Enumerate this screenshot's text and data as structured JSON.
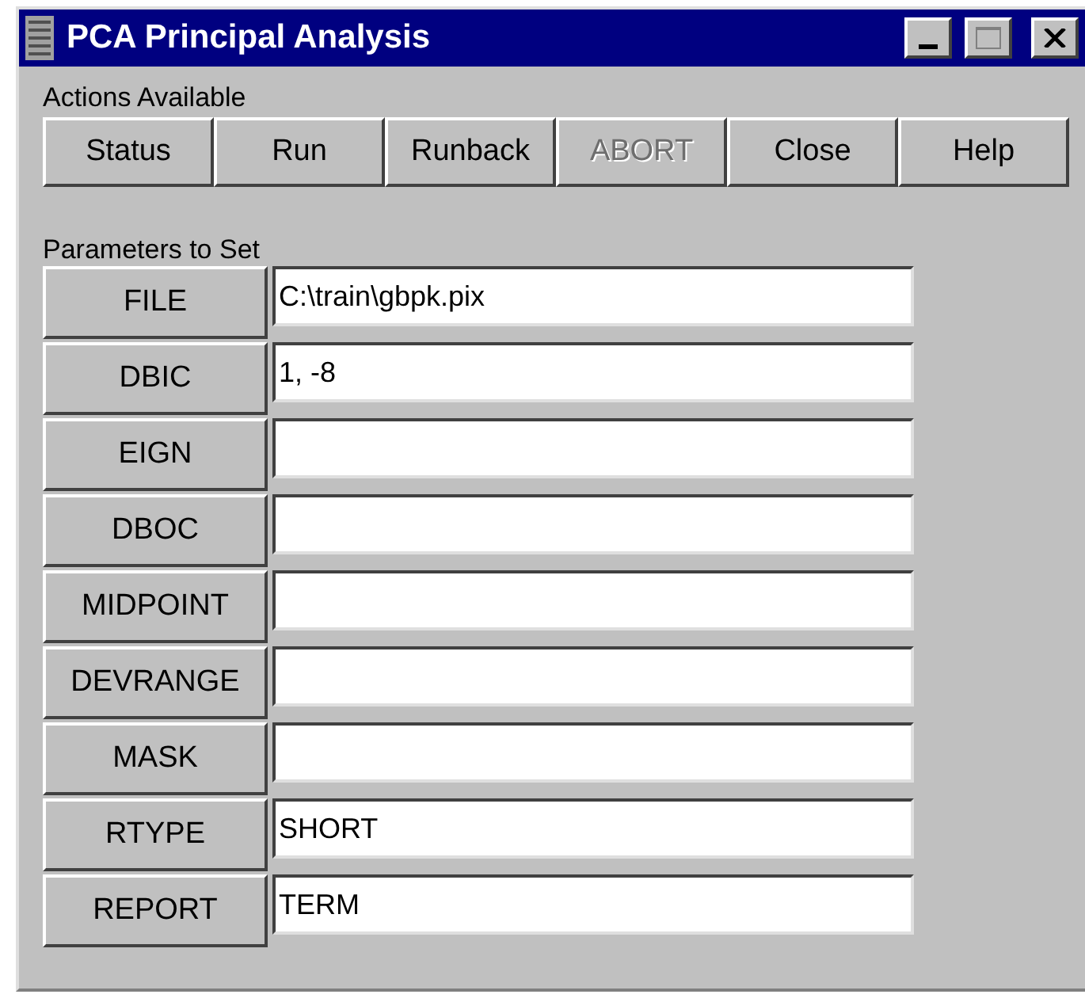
{
  "window": {
    "title": "PCA Principal Analysis"
  },
  "actions": {
    "label": "Actions Available",
    "buttons": [
      {
        "label": "Status",
        "disabled": false
      },
      {
        "label": "Run",
        "disabled": false
      },
      {
        "label": "Runback",
        "disabled": false
      },
      {
        "label": "ABORT",
        "disabled": true
      },
      {
        "label": "Close",
        "disabled": false
      },
      {
        "label": "Help",
        "disabled": false
      }
    ]
  },
  "parameters": {
    "label": "Parameters to Set",
    "rows": [
      {
        "name": "FILE",
        "value": "C:\\train\\gbpk.pix"
      },
      {
        "name": "DBIC",
        "value": "1, -8"
      },
      {
        "name": "EIGN"
      },
      {
        "name": "DBOC"
      },
      {
        "name": "MIDPOINT"
      },
      {
        "name": "DEVRANGE"
      },
      {
        "name": "MASK"
      },
      {
        "name": "RTYPE",
        "value": "SHORT"
      },
      {
        "name": "REPORT",
        "value": "TERM"
      }
    ]
  }
}
